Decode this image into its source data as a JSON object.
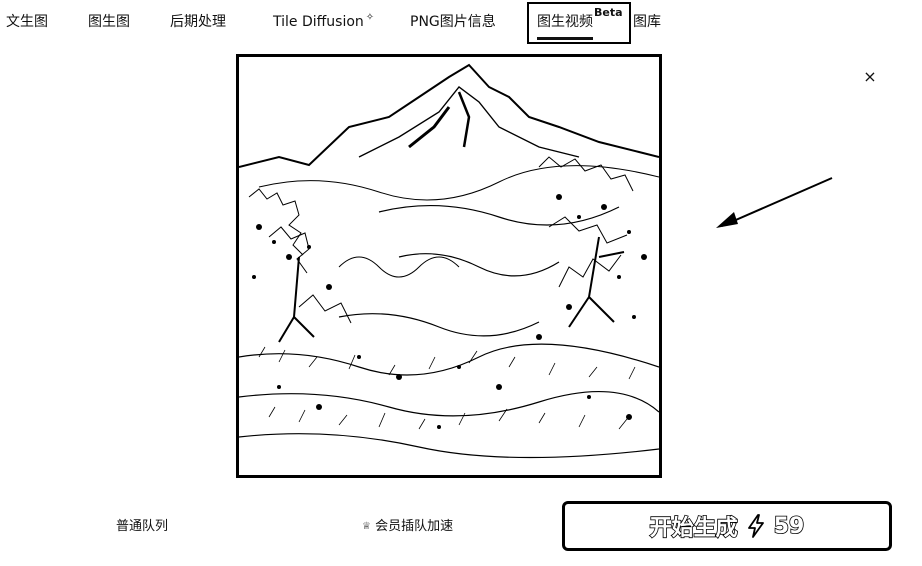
{
  "tabs": [
    {
      "label": "文生图"
    },
    {
      "label": "图生图"
    },
    {
      "label": "后期处理"
    },
    {
      "label": "Tile Diffusion"
    },
    {
      "label": "PNG图片信息"
    },
    {
      "label": "图生视频",
      "badge": "Beta",
      "active": true
    },
    {
      "label": "图库"
    }
  ],
  "close_symbol": "×",
  "queue": {
    "normal_label": "普通队列",
    "member_label": "会员插队加速"
  },
  "generate": {
    "label": "开始生成",
    "icon": "lightning-icon",
    "cost": "59"
  },
  "colors": {
    "ink": "#000000",
    "background": "#ffffff"
  }
}
